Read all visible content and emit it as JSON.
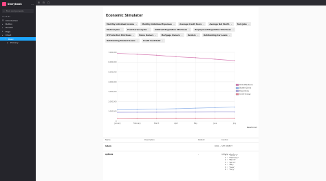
{
  "app": {
    "title": "Storybook",
    "search_placeholder": "Find components"
  },
  "sidebar": {
    "section": "STORIES",
    "items": [
      {
        "label": "Introduction",
        "level": 1,
        "icon": "doc"
      },
      {
        "label": "Button",
        "level": 1,
        "icon": "folder"
      },
      {
        "label": "Header",
        "level": 1,
        "icon": "folder"
      },
      {
        "label": "Page",
        "level": 1,
        "icon": "folder"
      },
      {
        "label": "Chart",
        "level": 1,
        "icon": "folder"
      },
      {
        "label": "Basic",
        "level": 2,
        "icon": "comp",
        "active": true
      },
      {
        "label": "Primary",
        "level": 3,
        "icon": "story"
      }
    ]
  },
  "toolbar": {
    "items": [
      "⊞",
      "⊟",
      "▢"
    ]
  },
  "story": {
    "title": "Economic Simulator",
    "chips": [
      "Monthly Individual Income",
      "Monthly Individual Expenses",
      "Average Credit Score",
      "Average Net Worth",
      "Tech Jobs",
      "Medical Jobs",
      "Food Services Jobs",
      "Antitrust Regulation Strictness",
      "Employment Regulation Strictness",
      "IP Protection Strictness",
      "Home Owners",
      "Mortgage Owners",
      "Renters",
      "Outstanding Car Loans",
      "Outstanding Student Loans",
      "Credit Card Debt"
    ],
    "reset_label": "Reset zoom"
  },
  "chart_data": {
    "type": "line",
    "x": [
      "January",
      "February",
      "March",
      "April",
      "May",
      "June",
      "July"
    ],
    "ylim": [
      0,
      7000000
    ],
    "yticks": [
      "0",
      "1,000,000",
      "2,000,000",
      "3,000,000",
      "4,000,000",
      "5,000,000",
      "6,000,000",
      "7,000,000"
    ],
    "grid": true,
    "legend": "right",
    "series": [
      {
        "name": "Child Attendance",
        "color": "#d57ab2",
        "values": [
          6900000,
          6800000,
          6700000,
          6550000,
          6450000,
          6300000,
          6150000
        ]
      },
      {
        "name": "Student Clinics",
        "color": "#8cb0e8",
        "values": [
          1150000,
          1180000,
          1220000,
          1260000,
          1320000,
          1370000,
          1430000
        ]
      },
      {
        "name": "Drug Clinics",
        "color": "#a9a4e0",
        "values": [
          900000,
          905000,
          910000,
          915000,
          920000,
          925000,
          930000
        ]
      },
      {
        "name": "Credit Change",
        "color": "#e38a9a",
        "values": [
          250000,
          255000,
          260000,
          262000,
          265000,
          268000,
          270000
        ]
      }
    ]
  },
  "args": {
    "headers": {
      "name": "Name",
      "description": "Description",
      "default": "Default",
      "control": "Control"
    },
    "rows": [
      {
        "name": "labels",
        "default": "",
        "control": "RAW ⌄  SET OBJECT"
      },
      {
        "name": "options",
        "default": "-",
        "control": "options : {…}"
      }
    ],
    "json_lines": [
      "0 : \"January\"",
      "1 : \"February\"",
      "2 : \"March\"",
      "3 : \"April\"",
      "4 : \"May\"",
      "5 : \"June\"",
      "6 : \"July\""
    ]
  }
}
